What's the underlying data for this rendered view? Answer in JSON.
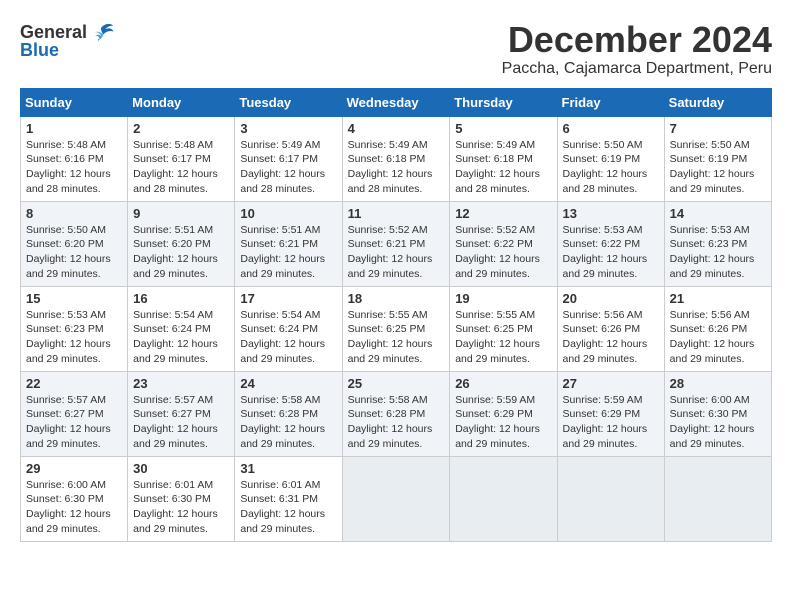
{
  "header": {
    "logo_general": "General",
    "logo_blue": "Blue",
    "month_title": "December 2024",
    "location": "Paccha, Cajamarca Department, Peru"
  },
  "weekdays": [
    "Sunday",
    "Monday",
    "Tuesday",
    "Wednesday",
    "Thursday",
    "Friday",
    "Saturday"
  ],
  "weeks": [
    [
      {
        "day": "1",
        "sunrise": "5:48 AM",
        "sunset": "6:16 PM",
        "daylight": "12 hours and 28 minutes."
      },
      {
        "day": "2",
        "sunrise": "5:48 AM",
        "sunset": "6:17 PM",
        "daylight": "12 hours and 28 minutes."
      },
      {
        "day": "3",
        "sunrise": "5:49 AM",
        "sunset": "6:17 PM",
        "daylight": "12 hours and 28 minutes."
      },
      {
        "day": "4",
        "sunrise": "5:49 AM",
        "sunset": "6:18 PM",
        "daylight": "12 hours and 28 minutes."
      },
      {
        "day": "5",
        "sunrise": "5:49 AM",
        "sunset": "6:18 PM",
        "daylight": "12 hours and 28 minutes."
      },
      {
        "day": "6",
        "sunrise": "5:50 AM",
        "sunset": "6:19 PM",
        "daylight": "12 hours and 28 minutes."
      },
      {
        "day": "7",
        "sunrise": "5:50 AM",
        "sunset": "6:19 PM",
        "daylight": "12 hours and 29 minutes."
      }
    ],
    [
      {
        "day": "8",
        "sunrise": "5:50 AM",
        "sunset": "6:20 PM",
        "daylight": "12 hours and 29 minutes."
      },
      {
        "day": "9",
        "sunrise": "5:51 AM",
        "sunset": "6:20 PM",
        "daylight": "12 hours and 29 minutes."
      },
      {
        "day": "10",
        "sunrise": "5:51 AM",
        "sunset": "6:21 PM",
        "daylight": "12 hours and 29 minutes."
      },
      {
        "day": "11",
        "sunrise": "5:52 AM",
        "sunset": "6:21 PM",
        "daylight": "12 hours and 29 minutes."
      },
      {
        "day": "12",
        "sunrise": "5:52 AM",
        "sunset": "6:22 PM",
        "daylight": "12 hours and 29 minutes."
      },
      {
        "day": "13",
        "sunrise": "5:53 AM",
        "sunset": "6:22 PM",
        "daylight": "12 hours and 29 minutes."
      },
      {
        "day": "14",
        "sunrise": "5:53 AM",
        "sunset": "6:23 PM",
        "daylight": "12 hours and 29 minutes."
      }
    ],
    [
      {
        "day": "15",
        "sunrise": "5:53 AM",
        "sunset": "6:23 PM",
        "daylight": "12 hours and 29 minutes."
      },
      {
        "day": "16",
        "sunrise": "5:54 AM",
        "sunset": "6:24 PM",
        "daylight": "12 hours and 29 minutes."
      },
      {
        "day": "17",
        "sunrise": "5:54 AM",
        "sunset": "6:24 PM",
        "daylight": "12 hours and 29 minutes."
      },
      {
        "day": "18",
        "sunrise": "5:55 AM",
        "sunset": "6:25 PM",
        "daylight": "12 hours and 29 minutes."
      },
      {
        "day": "19",
        "sunrise": "5:55 AM",
        "sunset": "6:25 PM",
        "daylight": "12 hours and 29 minutes."
      },
      {
        "day": "20",
        "sunrise": "5:56 AM",
        "sunset": "6:26 PM",
        "daylight": "12 hours and 29 minutes."
      },
      {
        "day": "21",
        "sunrise": "5:56 AM",
        "sunset": "6:26 PM",
        "daylight": "12 hours and 29 minutes."
      }
    ],
    [
      {
        "day": "22",
        "sunrise": "5:57 AM",
        "sunset": "6:27 PM",
        "daylight": "12 hours and 29 minutes."
      },
      {
        "day": "23",
        "sunrise": "5:57 AM",
        "sunset": "6:27 PM",
        "daylight": "12 hours and 29 minutes."
      },
      {
        "day": "24",
        "sunrise": "5:58 AM",
        "sunset": "6:28 PM",
        "daylight": "12 hours and 29 minutes."
      },
      {
        "day": "25",
        "sunrise": "5:58 AM",
        "sunset": "6:28 PM",
        "daylight": "12 hours and 29 minutes."
      },
      {
        "day": "26",
        "sunrise": "5:59 AM",
        "sunset": "6:29 PM",
        "daylight": "12 hours and 29 minutes."
      },
      {
        "day": "27",
        "sunrise": "5:59 AM",
        "sunset": "6:29 PM",
        "daylight": "12 hours and 29 minutes."
      },
      {
        "day": "28",
        "sunrise": "6:00 AM",
        "sunset": "6:30 PM",
        "daylight": "12 hours and 29 minutes."
      }
    ],
    [
      {
        "day": "29",
        "sunrise": "6:00 AM",
        "sunset": "6:30 PM",
        "daylight": "12 hours and 29 minutes."
      },
      {
        "day": "30",
        "sunrise": "6:01 AM",
        "sunset": "6:30 PM",
        "daylight": "12 hours and 29 minutes."
      },
      {
        "day": "31",
        "sunrise": "6:01 AM",
        "sunset": "6:31 PM",
        "daylight": "12 hours and 29 minutes."
      },
      null,
      null,
      null,
      null
    ]
  ],
  "labels": {
    "sunrise": "Sunrise: ",
    "sunset": "Sunset: ",
    "daylight": "Daylight: "
  }
}
